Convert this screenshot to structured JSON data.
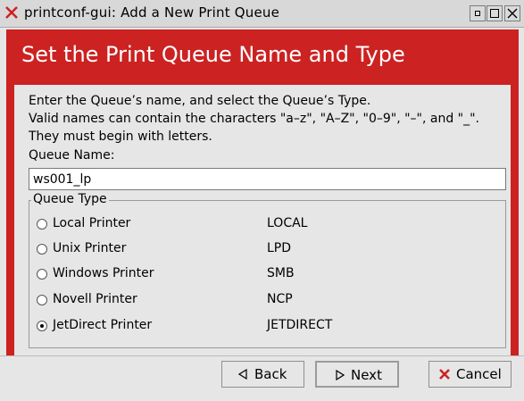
{
  "window": {
    "title": "printconf-gui: Add a New Print Queue",
    "icon": "close-x-icon"
  },
  "header": {
    "title": "Set the Print Queue Name and Type",
    "color": "#cc2222"
  },
  "instructions": [
    "Enter the Queue’s name, and select the Queue’s Type.",
    "Valid names can contain the characters \"a–z\", \"A–Z\", \"0–9\", \"–\", and \"_\".",
    "They must begin with letters."
  ],
  "queue_name": {
    "label": "Queue Name:",
    "value": "ws001_lp"
  },
  "queue_type": {
    "legend": "Queue Type",
    "options": [
      {
        "label": "Local Printer",
        "type": "LOCAL",
        "selected": false
      },
      {
        "label": "Unix Printer",
        "type": "LPD",
        "selected": false
      },
      {
        "label": "Windows Printer",
        "type": "SMB",
        "selected": false
      },
      {
        "label": "Novell Printer",
        "type": "NCP",
        "selected": false
      },
      {
        "label": "JetDirect Printer",
        "type": "JETDIRECT",
        "selected": true
      }
    ]
  },
  "buttons": {
    "back": "Back",
    "next": "Next",
    "cancel": "Cancel"
  }
}
